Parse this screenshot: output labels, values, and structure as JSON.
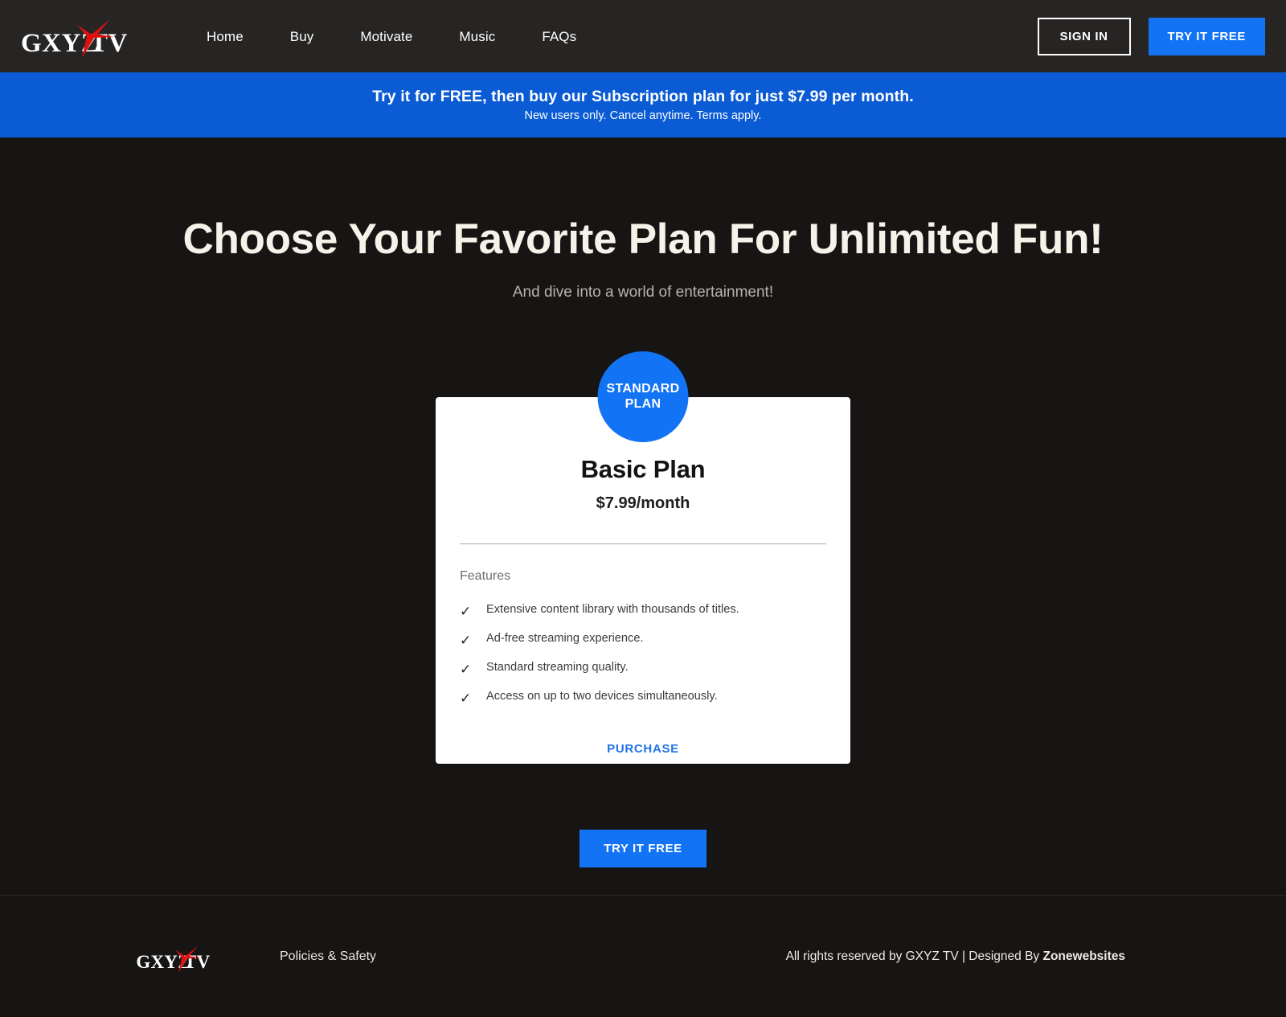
{
  "colors": {
    "header_bg": "#272524",
    "page_bg": "#171514",
    "accent_blue": "#1273F5",
    "banner_blue": "#0A5BD4",
    "logo_red": "#E01010",
    "card_bg": "#FFFFFF",
    "purchase_link": "#1F73E8"
  },
  "header": {
    "logo": {
      "text_left": "GXYZ",
      "text_right": "TV",
      "icon": "tv-antenna-icon"
    },
    "nav": [
      {
        "label": "Home",
        "name": "nav-item-home"
      },
      {
        "label": "Buy",
        "name": "nav-item-buy"
      },
      {
        "label": "Motivate",
        "name": "nav-item-motivate"
      },
      {
        "label": "Music",
        "name": "nav-item-music"
      },
      {
        "label": "FAQs",
        "name": "nav-item-faqs"
      }
    ],
    "sign_in_label": "SIGN IN",
    "try_it_free_label": "TRY IT FREE"
  },
  "promo_banner": {
    "main_text": "Try it for FREE, then buy our Subscription plan for just $7.99 per month.",
    "sub_text": "New users only. Cancel anytime. Terms apply."
  },
  "hero": {
    "headline": "Choose Your Favorite Plan For Unlimited Fun!",
    "subhead": "And dive into a world of entertainment!"
  },
  "plan_card": {
    "badge_line1": "STANDARD",
    "badge_line2": "PLAN",
    "plan_name": "Basic Plan",
    "price": "$7.99/month",
    "features_label": "Features",
    "features": [
      "Extensive content library with thousands of titles.",
      "Ad-free streaming experience.",
      "Standard streaming quality.",
      "Access on up to two devices simultaneously."
    ],
    "check_icon": "check-icon",
    "purchase_label": "PURCHASE"
  },
  "cta": {
    "try_it_free_label": "TRY IT FREE"
  },
  "footer": {
    "logo": {
      "text_left": "GXYZ",
      "text_right": "TV",
      "icon": "tv-antenna-icon"
    },
    "link_label": "Policies & Safety",
    "credit_prefix": "All rights reserved by GXYZ TV | Designed By ",
    "credit_brand": "Zonewebsites"
  }
}
